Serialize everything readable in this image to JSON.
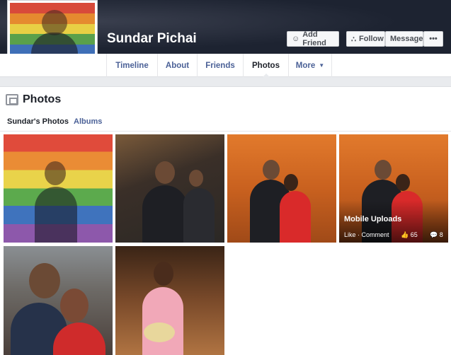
{
  "profile": {
    "name": "Sundar Pichai"
  },
  "actions": {
    "add_friend": "Add Friend",
    "follow": "Follow",
    "message": "Message",
    "more": "•••"
  },
  "nav": {
    "tabs": [
      {
        "label": "Timeline"
      },
      {
        "label": "About"
      },
      {
        "label": "Friends"
      },
      {
        "label": "Photos",
        "active": true
      },
      {
        "label": "More"
      }
    ]
  },
  "photos": {
    "title": "Photos",
    "subtabs": [
      "Sundar's Photos",
      "Albums"
    ],
    "album": {
      "name": "Mobile Uploads",
      "meta": "Like · Comment",
      "likes": "65",
      "comments": "8"
    }
  },
  "colors": {
    "cover": "#1d2331",
    "link": "#4b6197",
    "text": "#1d2129",
    "background": "#e9ebee"
  },
  "icons": {
    "add_friend": "person-plus-icon",
    "follow": "rss-icon",
    "more_caret": "caret-down-icon",
    "photos": "photos-icon",
    "like": "thumbs-up-icon",
    "comment": "comment-icon"
  }
}
